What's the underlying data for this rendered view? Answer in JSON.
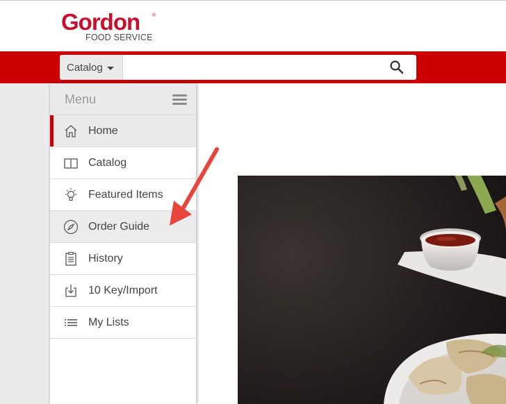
{
  "brand": {
    "name": "Gordon",
    "registered": "®",
    "tagline": "FOOD SERVICE",
    "color": "#c8102e"
  },
  "search": {
    "scope_label": "Catalog",
    "placeholder": "",
    "value": "",
    "icon": "search-icon"
  },
  "menu": {
    "title": "Menu",
    "items": [
      {
        "label": "Home",
        "icon": "home-icon",
        "active": true
      },
      {
        "label": "Catalog",
        "icon": "book-icon"
      },
      {
        "label": "Featured Items",
        "icon": "lightbulb-icon"
      },
      {
        "label": "Order Guide",
        "icon": "compass-icon",
        "hovered": true
      },
      {
        "label": "History",
        "icon": "clipboard-icon"
      },
      {
        "label": "10 Key/Import",
        "icon": "import-icon"
      },
      {
        "label": "My Lists",
        "icon": "list-icon"
      }
    ]
  },
  "colors": {
    "accent_red": "#cc0000",
    "annotation_arrow": "#e8453c",
    "menu_text": "#444444"
  },
  "annotation": {
    "type": "arrow",
    "target": "Order Guide"
  }
}
